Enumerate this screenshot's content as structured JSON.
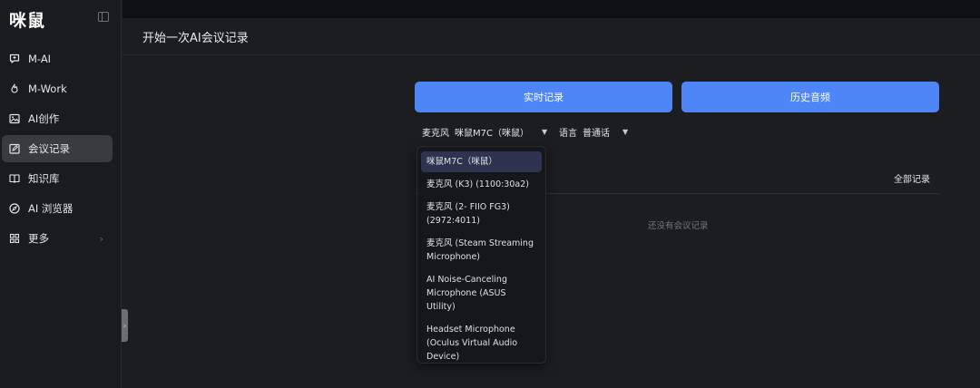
{
  "app": {
    "logo": "咪鼠"
  },
  "sidebar": {
    "items": [
      {
        "label": "M-AI",
        "icon": "chat-plus-icon"
      },
      {
        "label": "M-Work",
        "icon": "flame-icon"
      },
      {
        "label": "AI创作",
        "icon": "image-icon"
      },
      {
        "label": "会议记录",
        "icon": "note-edit-icon",
        "active": true
      },
      {
        "label": "知识库",
        "icon": "book-icon"
      },
      {
        "label": "AI 浏览器",
        "icon": "compass-icon"
      },
      {
        "label": "更多",
        "icon": "grid-icon",
        "chevron": "›"
      }
    ]
  },
  "header": {
    "title": "开始一次AI会议记录"
  },
  "main": {
    "live_label": "实时记录",
    "history_label": "历史音频",
    "mic": {
      "label": "麦克风",
      "value": "咪鼠M7C（咪鼠）",
      "caret": "▼"
    },
    "lang": {
      "label": "语言",
      "value": "普通话",
      "caret": "▼"
    },
    "all_records": "全部记录",
    "empty_text": "还没有会议记录"
  },
  "dropdown": {
    "options": [
      "咪鼠M7C（咪鼠）",
      "麦克风 (K3) (1100:30a2)",
      "麦克风 (2- FIIO FG3) (2972:4011)",
      "麦克风 (Steam Streaming Microphone)",
      "AI Noise-Canceling Microphone (ASUS Utility)",
      "Headset Microphone (Oculus Virtual Audio Device)"
    ],
    "selected_index": 0
  },
  "colors": {
    "accent": "#4f86f7",
    "sidebar_active": "#3a3b40",
    "background": "#1c1d21"
  }
}
